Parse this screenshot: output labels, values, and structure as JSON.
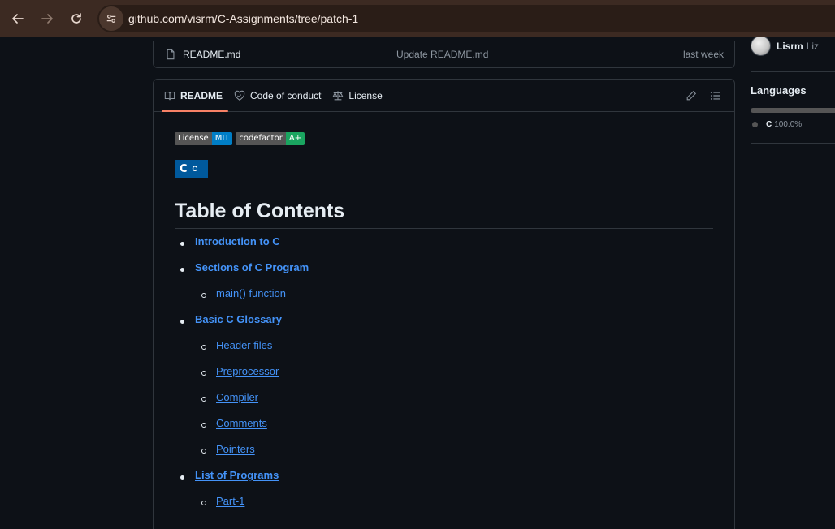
{
  "browser": {
    "url": "github.com/visrm/C-Assignments/tree/patch-1"
  },
  "file_row": {
    "name": "README.md",
    "commit_message": "Update README.md",
    "time": "last week"
  },
  "readme_tabs": [
    {
      "label": "README",
      "icon": "book-icon",
      "active": true
    },
    {
      "label": "Code of conduct",
      "icon": "heart-handshake-icon",
      "active": false
    },
    {
      "label": "License",
      "icon": "scale-icon",
      "active": false
    }
  ],
  "badges": [
    {
      "left": "License",
      "right": "MIT",
      "color": "#007ec6"
    },
    {
      "left": "codefactor",
      "right": "A+",
      "color": "#1aa560"
    }
  ],
  "lang_badge": {
    "logo": "C",
    "text": "C"
  },
  "toc": {
    "title": "Table of Contents",
    "items": [
      {
        "label": "Introduction to C",
        "level": 1
      },
      {
        "label": "Sections of C Program",
        "level": 1
      },
      {
        "label": "main() function",
        "level": 2
      },
      {
        "label": "Basic C Glossary",
        "level": 1
      },
      {
        "label": "Header files",
        "level": 2
      },
      {
        "label": "Preprocessor",
        "level": 2
      },
      {
        "label": "Compiler",
        "level": 2
      },
      {
        "label": "Comments",
        "level": 2
      },
      {
        "label": "Pointers",
        "level": 2
      },
      {
        "label": "List of Programs",
        "level": 1
      },
      {
        "label": "Part-1",
        "level": 2
      }
    ]
  },
  "sidebar": {
    "contributor": {
      "name": "Lisrm",
      "alias": "Liz"
    },
    "languages": {
      "title": "Languages",
      "entries": [
        {
          "name": "C",
          "percent": "100.0%",
          "color": "#555555"
        }
      ]
    }
  }
}
